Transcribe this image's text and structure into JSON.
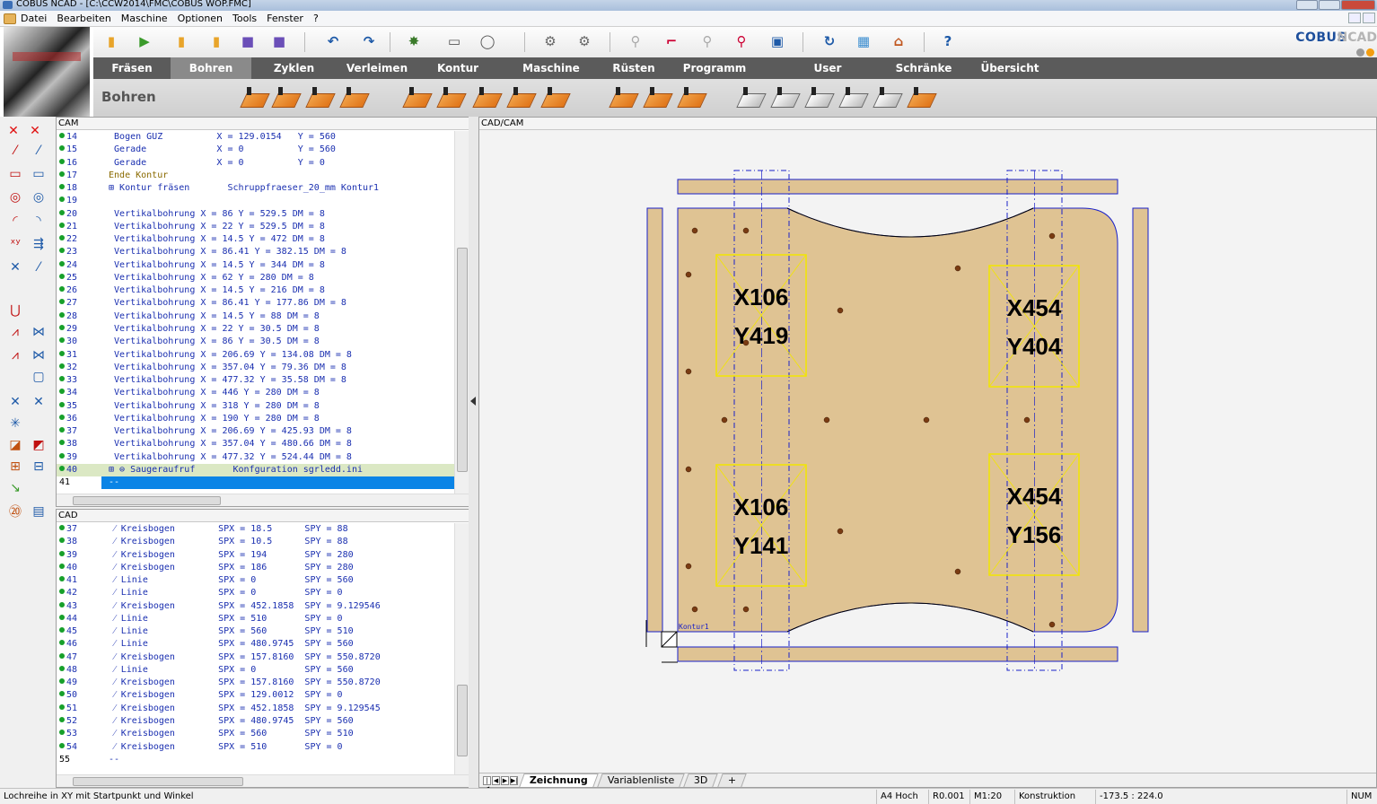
{
  "window": {
    "title": "COBUS NCAD - [C:\\CCW2014\\FMC\\COBUS WOP.FMC]"
  },
  "menu": [
    "Datei",
    "Bearbeiten",
    "Maschine",
    "Optionen",
    "Tools",
    "Fenster",
    "?"
  ],
  "brand": {
    "name": "COBUS",
    "suffix": "NCAD",
    "accent": "#1d4f9c",
    "orange": "#f29d10"
  },
  "toolbar_icons": [
    "open-folder-icon",
    "import-icon",
    "folder-icon",
    "folder-open-icon",
    "save-icon",
    "save-all-icon",
    "undo-icon",
    "redo-icon",
    "refresh-icon",
    "print-icon",
    "print-preview-icon",
    "simulation-lin-icon",
    "simulation-nc-icon",
    "zoom-icon",
    "zoom-window-icon",
    "zoom-out-icon",
    "zoom-in-icon",
    "zoom-all-icon",
    "regenerate-icon",
    "calculator-icon",
    "home-icon",
    "help-icon"
  ],
  "tabs": [
    {
      "label": "Fräsen",
      "active": false
    },
    {
      "label": "Bohren",
      "active": true
    },
    {
      "label": "Zyklen",
      "active": false
    },
    {
      "label": "Verleimen",
      "active": false
    },
    {
      "label": "Kontur",
      "active": false
    },
    {
      "label": "Maschine",
      "active": false
    },
    {
      "label": "Rüsten",
      "active": false
    },
    {
      "label": "Programm",
      "active": false
    },
    {
      "label": "User",
      "active": false
    },
    {
      "label": "Schränke",
      "active": false
    },
    {
      "label": "Übersicht",
      "active": false
    }
  ],
  "subbar": {
    "title": "Bohren"
  },
  "cam_panel": {
    "title": "CAM",
    "rows": [
      {
        "n": "14",
        "t": "  Bogen GUZ          X = 129.0154   Y = 560"
      },
      {
        "n": "15",
        "t": "  Gerade             X = 0          Y = 560"
      },
      {
        "n": "16",
        "t": "  Gerade             X = 0          Y = 0"
      },
      {
        "n": "17",
        "t": " Ende Kontur",
        "c": "#8a6a00"
      },
      {
        "n": "18",
        "t": " ⊞ Kontur fräsen       Schruppfraeser_20_mm Kontur1"
      },
      {
        "n": "19",
        "t": ""
      },
      {
        "n": "20",
        "t": "  Vertikalbohrung X = 86 Y = 529.5 DM = 8"
      },
      {
        "n": "21",
        "t": "  Vertikalbohrung X = 22 Y = 529.5 DM = 8"
      },
      {
        "n": "22",
        "t": "  Vertikalbohrung X = 14.5 Y = 472 DM = 8"
      },
      {
        "n": "23",
        "t": "  Vertikalbohrung X = 86.41 Y = 382.15 DM = 8"
      },
      {
        "n": "24",
        "t": "  Vertikalbohrung X = 14.5 Y = 344 DM = 8"
      },
      {
        "n": "25",
        "t": "  Vertikalbohrung X = 62 Y = 280 DM = 8"
      },
      {
        "n": "26",
        "t": "  Vertikalbohrung X = 14.5 Y = 216 DM = 8"
      },
      {
        "n": "27",
        "t": "  Vertikalbohrung X = 86.41 Y = 177.86 DM = 8"
      },
      {
        "n": "28",
        "t": "  Vertikalbohrung X = 14.5 Y = 88 DM = 8"
      },
      {
        "n": "29",
        "t": "  Vertikalbohrung X = 22 Y = 30.5 DM = 8"
      },
      {
        "n": "30",
        "t": "  Vertikalbohrung X = 86 Y = 30.5 DM = 8"
      },
      {
        "n": "31",
        "t": "  Vertikalbohrung X = 206.69 Y = 134.08 DM = 8"
      },
      {
        "n": "32",
        "t": "  Vertikalbohrung X = 357.04 Y = 79.36 DM = 8"
      },
      {
        "n": "33",
        "t": "  Vertikalbohrung X = 477.32 Y = 35.58 DM = 8"
      },
      {
        "n": "34",
        "t": "  Vertikalbohrung X = 446 Y = 280 DM = 8"
      },
      {
        "n": "35",
        "t": "  Vertikalbohrung X = 318 Y = 280 DM = 8"
      },
      {
        "n": "36",
        "t": "  Vertikalbohrung X = 190 Y = 280 DM = 8"
      },
      {
        "n": "37",
        "t": "  Vertikalbohrung X = 206.69 Y = 425.93 DM = 8"
      },
      {
        "n": "38",
        "t": "  Vertikalbohrung X = 357.04 Y = 480.66 DM = 8"
      },
      {
        "n": "39",
        "t": "  Vertikalbohrung X = 477.32 Y = 524.44 DM = 8"
      },
      {
        "n": "40",
        "t": " ⊞ ⊜ Saugeraufruf       Konfguration sgrledd.ini",
        "hl": true
      },
      {
        "n": "41",
        "t": " --",
        "sel": true,
        "nodot": true
      }
    ]
  },
  "cad_panel": {
    "title": "CAD",
    "rows": [
      {
        "n": "37",
        "t": "  ⁄ Kreisbogen        SPX = 18.5      SPY = 88"
      },
      {
        "n": "38",
        "t": "  ⁄ Kreisbogen        SPX = 10.5      SPY = 88"
      },
      {
        "n": "39",
        "t": "  ⁄ Kreisbogen        SPX = 194       SPY = 280"
      },
      {
        "n": "40",
        "t": "  ⁄ Kreisbogen        SPX = 186       SPY = 280"
      },
      {
        "n": "41",
        "t": "  ⁄ Linie             SPX = 0         SPY = 560"
      },
      {
        "n": "42",
        "t": "  ⁄ Linie             SPX = 0         SPY = 0"
      },
      {
        "n": "43",
        "t": "  ⁄ Kreisbogen        SPX = 452.1858  SPY = 9.129546"
      },
      {
        "n": "44",
        "t": "  ⁄ Linie             SPX = 510       SPY = 0"
      },
      {
        "n": "45",
        "t": "  ⁄ Linie             SPX = 560       SPY = 510"
      },
      {
        "n": "46",
        "t": "  ⁄ Linie             SPX = 480.9745  SPY = 560"
      },
      {
        "n": "47",
        "t": "  ⁄ Kreisbogen        SPX = 157.8160  SPY = 550.8720"
      },
      {
        "n": "48",
        "t": "  ⁄ Linie             SPX = 0         SPY = 560"
      },
      {
        "n": "49",
        "t": "  ⁄ Kreisbogen        SPX = 157.8160  SPY = 550.8720"
      },
      {
        "n": "50",
        "t": "  ⁄ Kreisbogen        SPX = 129.0012  SPY = 0"
      },
      {
        "n": "51",
        "t": "  ⁄ Kreisbogen        SPX = 452.1858  SPY = 9.129545"
      },
      {
        "n": "52",
        "t": "  ⁄ Kreisbogen        SPX = 480.9745  SPY = 560"
      },
      {
        "n": "53",
        "t": "  ⁄ Kreisbogen        SPX = 560       SPY = 510"
      },
      {
        "n": "54",
        "t": "  ⁄ Kreisbogen        SPX = 510       SPY = 0"
      },
      {
        "n": "55",
        "t": " --",
        "nodot": true,
        "plain": true
      }
    ]
  },
  "cad_view": {
    "title": "CAD/CAM",
    "contour_label": "Kontur1",
    "suction_cups": [
      {
        "x": "X106",
        "y": "Y419"
      },
      {
        "x": "X454",
        "y": "Y404"
      },
      {
        "x": "X106",
        "y": "Y141"
      },
      {
        "x": "X454",
        "y": "Y156"
      }
    ],
    "colors": {
      "panel": "#dfc393",
      "edge": "#1a20c8",
      "cup": "#f2e600",
      "hole": "#7a3b12"
    }
  },
  "bottom_tabs": [
    {
      "label": "Zeichnung",
      "active": true
    },
    {
      "label": "Variablenliste",
      "active": false
    },
    {
      "label": "3D",
      "active": false
    }
  ],
  "status": {
    "hint": "Lochreihe in XY mit Startpunkt und Winkel",
    "paper": "A4 Hoch",
    "r": "R0.001",
    "scale": "M1:20",
    "mode": "Konstruktion",
    "coords": "-173.5 : 224.0",
    "num": "NUM"
  }
}
